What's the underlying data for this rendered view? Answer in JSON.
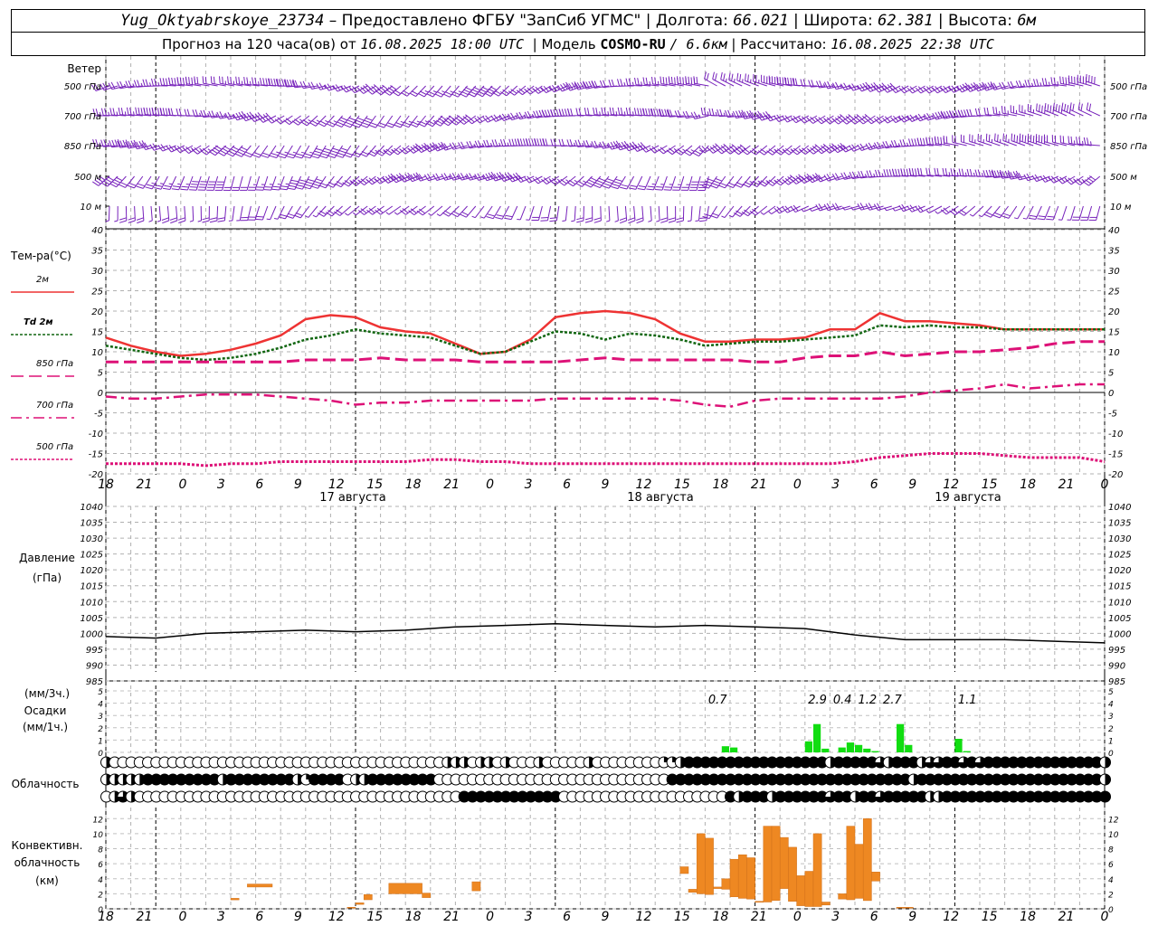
{
  "header": {
    "station": "Yug_Oktyabrskoye_23734",
    "dash": " – ",
    "provider": "Предоставлено ФГБУ \"ЗапСиб УГМС\"",
    "lon_label": "Долгота:",
    "lon": "66.021",
    "lat_label": "Широта:",
    "lat": "62.381",
    "alt_label": "Высота:",
    "alt": "6м",
    "sep": " | ",
    "forecast_prefix": "Прогноз на 120 часа(ов) от",
    "forecast_from": "16.08.2025 18:00 UTC",
    "model_label": "| Модель",
    "model": "COSMO-RU",
    "model_res": "/ 6.6км",
    "calc_label": "| Рассчитано:",
    "calc": "16.08.2025 22:38 UTC"
  },
  "labels": {
    "wind": "Ветер",
    "levels": [
      "500 гПа",
      "700 гПа",
      "850 гПа",
      "500 м",
      "10  м"
    ],
    "temp_title": "Тем-ра(°С)",
    "temp_legend": [
      "2м",
      "Td  2м",
      "850 гПа",
      "700 гПа",
      "500 гПа"
    ],
    "pressure_title": "Давление",
    "pressure_unit": "(гПа)",
    "precip_unit3": "(мм/3ч.)",
    "precip_title": "Осадки",
    "precip_unit1": "(мм/1ч.)",
    "cloud_title": "Облачность",
    "conv_title1": "Конвективн.",
    "conv_title2": "облачность",
    "conv_unit": "(км)"
  },
  "colors": {
    "t2m": "#ee3333",
    "td2m": "#116611",
    "t850": "#dd1177",
    "t700": "#dd1177",
    "t500": "#dd1177",
    "wind": "#7722bb",
    "pressure": "#000000",
    "precip": "#11dd11",
    "conv": "#ee8822",
    "grid": "#aaaaaa"
  },
  "chart_data": {
    "x_axis": {
      "tick_labels": [
        "18",
        "21",
        "0",
        "3",
        "6",
        "9",
        "12",
        "15",
        "18",
        "21",
        "0",
        "3",
        "6",
        "9",
        "12",
        "15",
        "18",
        "21",
        "0",
        "3",
        "6",
        "9",
        "12",
        "15",
        "18",
        "21",
        "0"
      ],
      "day_labels": [
        "17 августа",
        "18 августа",
        "19 августа"
      ]
    },
    "temperature": {
      "type": "line",
      "ylim": [
        -20,
        40
      ],
      "yticks": [
        40,
        35,
        30,
        25,
        20,
        15,
        10,
        5,
        0,
        -5,
        -10,
        -15,
        -20
      ],
      "hours": [
        0,
        3,
        6,
        9,
        12,
        15,
        18,
        21,
        24,
        27,
        30,
        33,
        36,
        39,
        42,
        45,
        48,
        51,
        54,
        57,
        60,
        63,
        66,
        69,
        72,
        75,
        78,
        81,
        84,
        87,
        90,
        93,
        96,
        99,
        102,
        105,
        108,
        111,
        114,
        117,
        120
      ],
      "series": [
        {
          "name": "2м",
          "style": "solid",
          "values": [
            13.5,
            11.5,
            10,
            9,
            9.5,
            10.5,
            12,
            14,
            18,
            19,
            18.5,
            16,
            15,
            14.5,
            12,
            9.5,
            10,
            13,
            18.5,
            19.5,
            20,
            19.5,
            18,
            14.5,
            12.5,
            12.5,
            13,
            13,
            13.5,
            15.5,
            15.5,
            19.5,
            17.5,
            17.5,
            17,
            16.5,
            15.5,
            15.5,
            15.5,
            15.5,
            15.5
          ]
        },
        {
          "name": "Td  2м",
          "style": "dotted",
          "values": [
            11.5,
            10.5,
            9.5,
            8.5,
            8,
            8.5,
            9.5,
            11,
            13,
            14,
            15.5,
            14.5,
            14,
            13.5,
            11.5,
            9.5,
            10,
            12.5,
            15,
            14.5,
            13,
            14.5,
            14,
            13,
            11.5,
            12,
            12.5,
            12.5,
            13,
            13.5,
            14,
            16.5,
            16,
            16.5,
            16,
            16,
            15.5,
            15.5,
            15.5,
            15.5,
            15.5
          ]
        },
        {
          "name": "850 гПа",
          "style": "longdash",
          "values": [
            7.5,
            7.5,
            7.5,
            7.5,
            7.5,
            7.5,
            7.5,
            7.5,
            8,
            8,
            8,
            8.5,
            8,
            8,
            8,
            7.5,
            7.5,
            7.5,
            7.5,
            8,
            8.5,
            8,
            8,
            8,
            8,
            8,
            7.5,
            7.5,
            8.5,
            9,
            9,
            10,
            9,
            9.5,
            10,
            10,
            10.5,
            11,
            12,
            12.5,
            12.5
          ]
        },
        {
          "name": "700 гПа",
          "style": "dashdot",
          "values": [
            -1,
            -1.5,
            -1.5,
            -1,
            -0.5,
            -0.5,
            -0.5,
            -1,
            -1.5,
            -2,
            -3,
            -2.5,
            -2.5,
            -2,
            -2,
            -2,
            -2,
            -2,
            -1.5,
            -1.5,
            -1.5,
            -1.5,
            -1.5,
            -2,
            -3,
            -3.5,
            -2,
            -1.5,
            -1.5,
            -1.5,
            -1.5,
            -1.5,
            -1,
            0,
            0.5,
            1,
            2,
            1,
            1.5,
            2,
            2
          ]
        },
        {
          "name": "500 гПа",
          "style": "dotted",
          "values": [
            -17.5,
            -17.5,
            -17.5,
            -17.5,
            -18,
            -17.5,
            -17.5,
            -17,
            -17,
            -17,
            -17,
            -17,
            -17,
            -16.5,
            -16.5,
            -17,
            -17,
            -17.5,
            -17.5,
            -17.5,
            -17.5,
            -17.5,
            -17.5,
            -17.5,
            -17.5,
            -17.5,
            -17.5,
            -17.5,
            -17.5,
            -17.5,
            -17,
            -16,
            -15.5,
            -15,
            -15,
            -15,
            -15.5,
            -16,
            -16,
            -16,
            -17
          ]
        }
      ]
    },
    "pressure": {
      "type": "line",
      "ylim": [
        985,
        1040
      ],
      "yticks": [
        1040,
        1035,
        1030,
        1025,
        1020,
        1015,
        1010,
        1005,
        1000,
        995,
        990,
        985
      ],
      "hours": [
        0,
        6,
        12,
        18,
        24,
        30,
        36,
        42,
        48,
        54,
        60,
        66,
        72,
        78,
        84,
        90,
        96,
        102,
        108,
        114,
        120
      ],
      "values": [
        999,
        998.5,
        1000,
        1000.5,
        1001,
        1000.5,
        1001,
        1002,
        1002.5,
        1003,
        1002.5,
        1002,
        1002.5,
        1002,
        1001.5,
        999.5,
        998,
        998,
        998,
        997.5,
        997
      ]
    },
    "precip": {
      "type": "bar",
      "ylim": [
        0,
        5
      ],
      "yticks": [
        5,
        4,
        3,
        2,
        1,
        0
      ],
      "hours": [
        74,
        75,
        84,
        85,
        86,
        88,
        89,
        90,
        91,
        92,
        95,
        96,
        102,
        103
      ],
      "values": [
        0.5,
        0.4,
        0.9,
        2.3,
        0.3,
        0.4,
        0.8,
        0.6,
        0.3,
        0.1,
        2.3,
        0.6,
        1.1,
        0.1
      ],
      "totals_3h": [
        {
          "hour": 73.5,
          "label": "0.7"
        },
        {
          "hour": 85.5,
          "label": "2.9"
        },
        {
          "hour": 88.5,
          "label": "0.4"
        },
        {
          "hour": 91.5,
          "label": "1.2"
        },
        {
          "hour": 94.5,
          "label": "2.7"
        },
        {
          "hour": 103.5,
          "label": "1.1"
        }
      ]
    },
    "clouds": {
      "type": "symbols",
      "note": "octas of cover per hour, rows: top, middle, bottom",
      "rows": [
        [
          4,
          0,
          0,
          0,
          0,
          0,
          0,
          0,
          0,
          0,
          0,
          0,
          0,
          0,
          0,
          0,
          0,
          0,
          0,
          0,
          0,
          0,
          0,
          0,
          0,
          0,
          0,
          0,
          0,
          0,
          0,
          0,
          0,
          0,
          0,
          0,
          0,
          0,
          0,
          0,
          0,
          4,
          4,
          4,
          0,
          4,
          4,
          0,
          4,
          0,
          0,
          0,
          4,
          0,
          0,
          0,
          0,
          0,
          4,
          0,
          0,
          0,
          0,
          0,
          0,
          0,
          0,
          2,
          2,
          4,
          8,
          8,
          8,
          8,
          8,
          8,
          8,
          8,
          8,
          8,
          8,
          8,
          8,
          8,
          8,
          8,
          8,
          4,
          8,
          8,
          8,
          8,
          8,
          6,
          4,
          8,
          8,
          8,
          4,
          6,
          6,
          8,
          8,
          6,
          8,
          6,
          8,
          8,
          8,
          8,
          8,
          8,
          8,
          8,
          8,
          8,
          8,
          8,
          8,
          8,
          4
        ],
        [
          4,
          4,
          4,
          4,
          4,
          8,
          8,
          8,
          8,
          8,
          8,
          8,
          8,
          8,
          4,
          8,
          8,
          8,
          8,
          8,
          8,
          8,
          8,
          4,
          2,
          8,
          8,
          8,
          8,
          0,
          4,
          4,
          8,
          8,
          8,
          8,
          8,
          8,
          8,
          8,
          0,
          0,
          0,
          0,
          0,
          0,
          0,
          0,
          0,
          0,
          0,
          0,
          0,
          0,
          0,
          0,
          0,
          0,
          0,
          0,
          0,
          0,
          0,
          0,
          0,
          0,
          0,
          0,
          8,
          8,
          8,
          8,
          8,
          8,
          8,
          8,
          8,
          8,
          8,
          8,
          8,
          8,
          8,
          8,
          8,
          8,
          8,
          8,
          8,
          8,
          8,
          8,
          8,
          8,
          8,
          8,
          8,
          4,
          8,
          8,
          8,
          8,
          8,
          8,
          8,
          8,
          8,
          8,
          8,
          8,
          8,
          8,
          8,
          8,
          8,
          8,
          8,
          8,
          8,
          8,
          4
        ],
        [
          0,
          4,
          6,
          4,
          0,
          0,
          0,
          0,
          0,
          0,
          0,
          0,
          0,
          0,
          0,
          0,
          0,
          0,
          0,
          0,
          0,
          0,
          0,
          0,
          0,
          0,
          0,
          0,
          0,
          0,
          0,
          0,
          0,
          0,
          0,
          0,
          0,
          0,
          0,
          0,
          0,
          0,
          0,
          8,
          8,
          8,
          8,
          8,
          8,
          8,
          8,
          8,
          8,
          8,
          8,
          0,
          0,
          0,
          0,
          0,
          0,
          0,
          0,
          0,
          0,
          0,
          0,
          0,
          0,
          0,
          0,
          0,
          0,
          0,
          0,
          8,
          4,
          8,
          8,
          8,
          4,
          8,
          8,
          8,
          8,
          8,
          8,
          6,
          8,
          8,
          4,
          8,
          8,
          6,
          8,
          8,
          8,
          8,
          8,
          4,
          4,
          8,
          8,
          8,
          8,
          8,
          8,
          8,
          8,
          8,
          8,
          8,
          8,
          8,
          8,
          8,
          8,
          8,
          8,
          8,
          8
        ]
      ]
    },
    "convective": {
      "type": "range_bar",
      "ylim": [
        0,
        13
      ],
      "yticks": [
        12,
        10,
        8,
        6,
        4,
        2,
        0
      ],
      "bars": [
        {
          "h0": 15,
          "h1": 16,
          "lo": 1.2,
          "hi": 1.4
        },
        {
          "h0": 17,
          "h1": 20,
          "lo": 2.9,
          "hi": 3.3
        },
        {
          "h0": 29,
          "h1": 30,
          "lo": 0.1,
          "hi": 0.2
        },
        {
          "h0": 30,
          "h1": 31,
          "lo": 0.6,
          "hi": 0.8
        },
        {
          "h0": 31,
          "h1": 32,
          "lo": 1.2,
          "hi": 1.9
        },
        {
          "h0": 34,
          "h1": 38,
          "lo": 2,
          "hi": 3.4
        },
        {
          "h0": 38,
          "h1": 39,
          "lo": 1.5,
          "hi": 2.1
        },
        {
          "h0": 44,
          "h1": 45,
          "lo": 2.4,
          "hi": 3.6
        },
        {
          "h0": 69,
          "h1": 70,
          "lo": 4.7,
          "hi": 5.6
        },
        {
          "h0": 70,
          "h1": 71,
          "lo": 2.2,
          "hi": 2.6
        },
        {
          "h0": 71,
          "h1": 72,
          "lo": 2,
          "hi": 10
        },
        {
          "h0": 72,
          "h1": 73,
          "lo": 1.9,
          "hi": 9.4
        },
        {
          "h0": 73,
          "h1": 74,
          "lo": 2.7,
          "hi": 2.9
        },
        {
          "h0": 74,
          "h1": 75,
          "lo": 2.6,
          "hi": 4
        },
        {
          "h0": 75,
          "h1": 76,
          "lo": 1.6,
          "hi": 6.6
        },
        {
          "h0": 76,
          "h1": 77,
          "lo": 1.4,
          "hi": 7.2
        },
        {
          "h0": 77,
          "h1": 78,
          "lo": 1.3,
          "hi": 6.8
        },
        {
          "h0": 78,
          "h1": 79,
          "lo": 0.9,
          "hi": 1
        },
        {
          "h0": 79,
          "h1": 80,
          "lo": 0.9,
          "hi": 11
        },
        {
          "h0": 80,
          "h1": 81,
          "lo": 1.1,
          "hi": 11
        },
        {
          "h0": 81,
          "h1": 82,
          "lo": 2.7,
          "hi": 9.5
        },
        {
          "h0": 82,
          "h1": 83,
          "lo": 1,
          "hi": 8.2
        },
        {
          "h0": 83,
          "h1": 84,
          "lo": 0.4,
          "hi": 4.4
        },
        {
          "h0": 84,
          "h1": 85,
          "lo": 0.3,
          "hi": 5
        },
        {
          "h0": 85,
          "h1": 86,
          "lo": 0.3,
          "hi": 10
        },
        {
          "h0": 86,
          "h1": 87,
          "lo": 0.5,
          "hi": 0.9
        },
        {
          "h0": 88,
          "h1": 89,
          "lo": 1.3,
          "hi": 2
        },
        {
          "h0": 89,
          "h1": 90,
          "lo": 1.2,
          "hi": 11
        },
        {
          "h0": 90,
          "h1": 91,
          "lo": 1.4,
          "hi": 8.6
        },
        {
          "h0": 91,
          "h1": 92,
          "lo": 1.1,
          "hi": 12
        },
        {
          "h0": 92,
          "h1": 93,
          "lo": 3.7,
          "hi": 4.9
        },
        {
          "h0": 95,
          "h1": 97,
          "lo": 0.1,
          "hi": 0.2
        }
      ]
    },
    "wind": {
      "type": "wind_barbs",
      "levels": [
        "500 гПа",
        "700 гПа",
        "850 гПа",
        "500 м",
        "10  м"
      ],
      "note": "barbs every hour: direction (deg, from) and speed (knots) per level"
    }
  }
}
